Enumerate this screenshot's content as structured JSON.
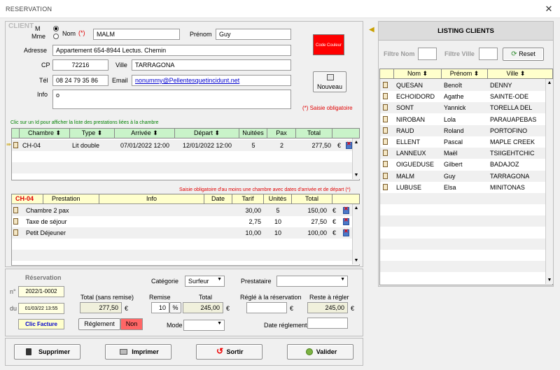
{
  "window": {
    "title": "RESERVATION",
    "close": "✕"
  },
  "client": {
    "section_label": "CLIENT",
    "civ_m": "M",
    "civ_mme": "Mme",
    "nom_label": "Nom",
    "required_mark": "(*)",
    "nom_value": "MALM",
    "prenom_label": "Prénom",
    "prenom_value": "Guy",
    "adresse_label": "Adresse",
    "adresse_value": "Appartement 654-8944 Lectus. Chemin",
    "cp_label": "CP",
    "cp_value": "72216",
    "ville_label": "Ville",
    "ville_value": "TARRAGONA",
    "tel_label": "Tél",
    "tel_value": "08 24 79 35 86",
    "email_label": "Email",
    "email_value": "nonummy@Pellentesquetincidunt.net",
    "info_label": "Info",
    "info_value": "o",
    "color_code": "Code Couleur",
    "new_button": "Nouveau",
    "required_note": "(*) Saisie obligatoire"
  },
  "chambres": {
    "hint": "Clic sur un Id pour afficher la liste des prestations liées à la chambre",
    "headers": [
      "Chambre",
      "Type",
      "Arrivée",
      "Départ",
      "Nuitées",
      "Pax",
      "Total"
    ],
    "rows": [
      {
        "chambre": "CH-04",
        "type": "Lit double",
        "arrivee": "07/01/2022 12:00",
        "depart": "12/01/2022 12:00",
        "nuitees": "5",
        "pax": "2",
        "total": "277,50",
        "cur": "€"
      }
    ],
    "warning": "Saisie obligatoire d'au moins une chambre avec dates d'arrivée et de départ (*)"
  },
  "prestations": {
    "room_id": "CH-04",
    "headers": [
      "Prestation",
      "Info",
      "Date",
      "Tarif",
      "Unités",
      "Total"
    ],
    "rows": [
      {
        "prestation": "Chambre 2 pax",
        "info": "",
        "date": "",
        "tarif": "30,00",
        "unites": "5",
        "total": "150,00",
        "cur": "€"
      },
      {
        "prestation": "Taxe de séjour",
        "info": "",
        "date": "",
        "tarif": "2,75",
        "unites": "10",
        "total": "27,50",
        "cur": "€"
      },
      {
        "prestation": "Petit Déjeuner",
        "info": "",
        "date": "",
        "tarif": "10,00",
        "unites": "10",
        "total": "100,00",
        "cur": "€"
      }
    ]
  },
  "reservation": {
    "section_label": "Réservation",
    "no_label": "n°",
    "no_value": "2022/1-0002",
    "du_label": "du",
    "du_value": "01/03/22 13:55",
    "categorie_label": "Catégorie",
    "categorie_value": "Surfeur",
    "prestataire_label": "Prestataire",
    "prestataire_value": "",
    "total_sans_remise_label": "Total (sans remise)",
    "total_sans_remise_value": "277,50",
    "remise_label": "Remise",
    "remise_value": "10",
    "percent": "%",
    "total_label": "Total",
    "total_value": "245,00",
    "regle_label": "Réglé à la réservation",
    "regle_value": "",
    "reste_label": "Reste à régler",
    "reste_value": "245,00",
    "cur": "€",
    "clic_facture": "Clic Facture",
    "reglement_button": "Réglement",
    "non_badge": "Non",
    "mode_label": "Mode",
    "mode_value": "",
    "date_reglement_label": "Date réglement",
    "date_reglement_value": ""
  },
  "actions": {
    "supprimer": "Supprimer",
    "imprimer": "Imprimer",
    "sortir": "Sortir",
    "valider": "Valider"
  },
  "listing": {
    "title": "LISTING CLIENTS",
    "filtre_nom_label": "Filtre Nom",
    "filtre_nom_value": "",
    "filtre_ville_label": "Filtre Ville",
    "filtre_ville_value": "",
    "reset_button": "Reset",
    "headers": [
      "Nom",
      "Prénom",
      "Ville"
    ],
    "rows": [
      {
        "nom": "QUESAN",
        "prenom": "Benoît",
        "ville": "DENNY"
      },
      {
        "nom": "ECHOIDORD",
        "prenom": "Agathe",
        "ville": "SAINTE-ODE"
      },
      {
        "nom": "SONT",
        "prenom": "Yannick",
        "ville": "TORELLA DEL"
      },
      {
        "nom": "NIROBAN",
        "prenom": "Lola",
        "ville": "PARAUAPEBAS"
      },
      {
        "nom": "RAUD",
        "prenom": "Roland",
        "ville": "PORTOFINO"
      },
      {
        "nom": "ELLENT",
        "prenom": "Pascal",
        "ville": "MAPLE CREEK"
      },
      {
        "nom": "LANNEUX",
        "prenom": "Maël",
        "ville": "TSIIGEHTCHIC"
      },
      {
        "nom": "OIGUEDUSE",
        "prenom": "Gilbert",
        "ville": "BADAJOZ"
      },
      {
        "nom": "MALM",
        "prenom": "Guy",
        "ville": "TARRAGONA"
      },
      {
        "nom": "LUBUSE",
        "prenom": "Elsa",
        "ville": "MINITONAS"
      }
    ]
  },
  "colors": {
    "accent_green": "#c9f3c9",
    "required_red": "#e00000",
    "color_code_box": "#ff0000",
    "header_yellow": "#ffffcc"
  }
}
